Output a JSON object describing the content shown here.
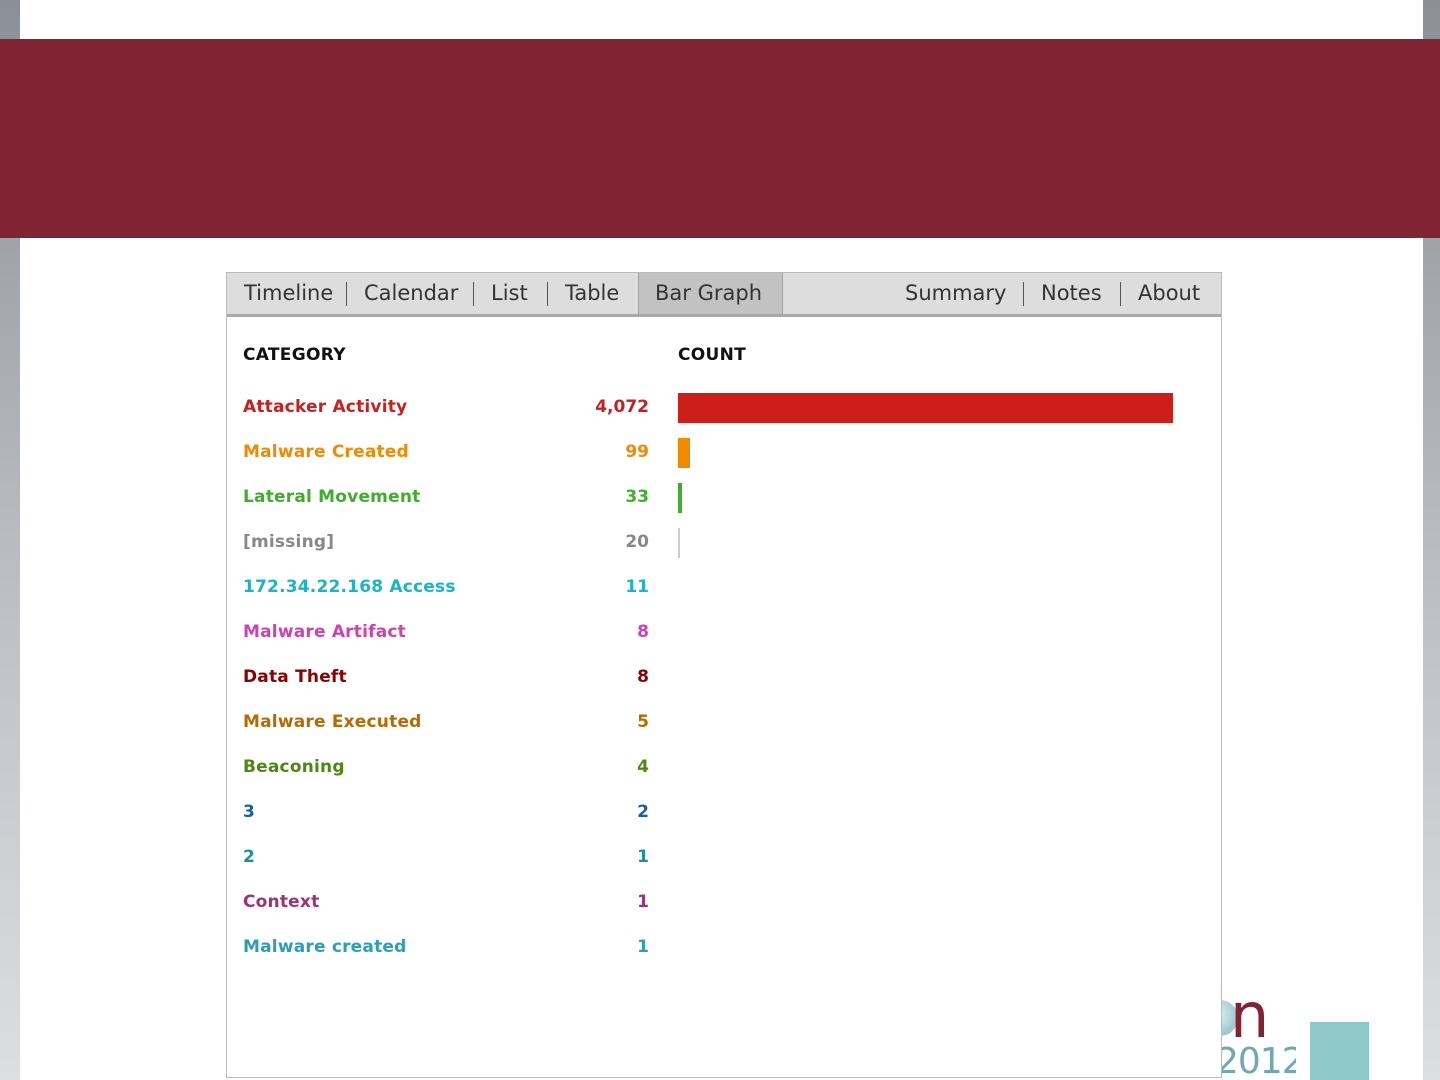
{
  "tabs": {
    "timeline": "Timeline",
    "calendar": "Calendar",
    "list": "List",
    "table": "Table",
    "bar_graph": "Bar Graph",
    "summary": "Summary",
    "notes": "Notes",
    "about": "About",
    "active": "Bar Graph"
  },
  "logo": {
    "partial_text": "n",
    "partial_year": "2012"
  },
  "chart_data": {
    "type": "bar",
    "orientation": "horizontal",
    "columns": [
      "CATEGORY",
      "COUNT"
    ],
    "categories": [
      "Attacker Activity",
      "Malware Created",
      "Lateral Movement",
      "[missing]",
      "172.34.22.168 Access",
      "Malware Artifact",
      "Data Theft",
      "Malware Executed",
      "Beaconing",
      "3",
      "2",
      "Context",
      "Malware created"
    ],
    "values": [
      4072,
      99,
      33,
      20,
      11,
      8,
      8,
      5,
      4,
      2,
      1,
      1,
      1
    ],
    "value_labels": [
      "4,072",
      "99",
      "33",
      "20",
      "11",
      "8",
      "8",
      "5",
      "4",
      "2",
      "1",
      "1",
      "1"
    ],
    "colors": [
      "#cc1e1e",
      "#f08a00",
      "#3fae2a",
      "#888888",
      "#19b4c8",
      "#d040b0",
      "#8b0000",
      "#b86a00",
      "#4a8a10",
      "#1c5f9e",
      "#1c8fa0",
      "#a0307a",
      "#2aa0b8"
    ],
    "bar_colors": [
      "#cc1f1a",
      "#f08a00",
      "#3fae2a",
      "#cccccc"
    ]
  }
}
